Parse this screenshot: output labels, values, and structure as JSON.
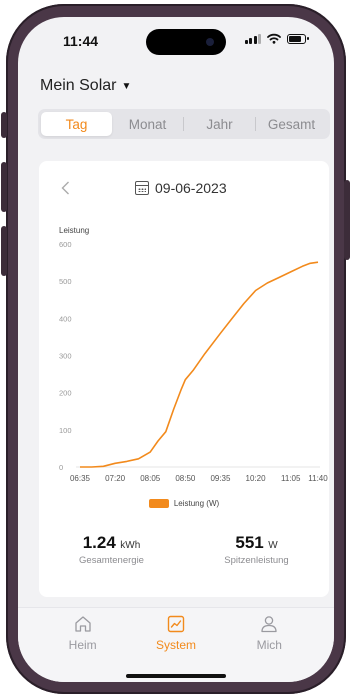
{
  "status_bar": {
    "time": "11:44"
  },
  "header": {
    "title": "Mein Solar"
  },
  "period_tabs": [
    {
      "label": "Tag",
      "active": true
    },
    {
      "label": "Monat",
      "active": false
    },
    {
      "label": "Jahr",
      "active": false
    },
    {
      "label": "Gesamt",
      "active": false
    }
  ],
  "date_nav": {
    "date": "09-06-2023",
    "prev_icon": "chevron-left-icon",
    "calendar_icon": "calendar-icon"
  },
  "legend": {
    "label": "Leistung (W)"
  },
  "stats": {
    "energy": {
      "value": "1.24",
      "unit": "kWh",
      "label": "Gesamtenergie"
    },
    "peak": {
      "value": "551",
      "unit": "W",
      "label": "Spitzenleistung"
    }
  },
  "bottom_nav": [
    {
      "label": "Heim",
      "icon": "home-icon",
      "active": false
    },
    {
      "label": "System",
      "icon": "chart-icon",
      "active": true
    },
    {
      "label": "Mich",
      "icon": "person-icon",
      "active": false
    }
  ],
  "colors": {
    "accent": "#f28a1c",
    "frame": "#4a3747"
  },
  "chart_data": {
    "type": "line",
    "ylabel": "Leistung",
    "ylim": [
      0,
      600
    ],
    "yticks": [
      0,
      100,
      200,
      300,
      400,
      500,
      600
    ],
    "xtick_labels": [
      "06:35",
      "07:20",
      "08:05",
      "08:50",
      "09:35",
      "10:20",
      "11:05",
      "11:40"
    ],
    "grid": false,
    "legend_position": "bottom",
    "series": [
      {
        "name": "Leistung (W)",
        "color": "#f28a1c",
        "x": [
          "06:35",
          "06:50",
          "07:05",
          "07:20",
          "07:35",
          "07:50",
          "08:05",
          "08:15",
          "08:25",
          "08:35",
          "08:45",
          "08:50",
          "09:00",
          "09:15",
          "09:35",
          "09:50",
          "10:05",
          "10:20",
          "10:35",
          "10:50",
          "11:05",
          "11:20",
          "11:30",
          "11:40"
        ],
        "values": [
          0,
          0,
          2,
          10,
          15,
          22,
          40,
          70,
          95,
          155,
          210,
          235,
          260,
          305,
          360,
          400,
          440,
          475,
          495,
          510,
          525,
          540,
          548,
          551
        ]
      }
    ]
  }
}
